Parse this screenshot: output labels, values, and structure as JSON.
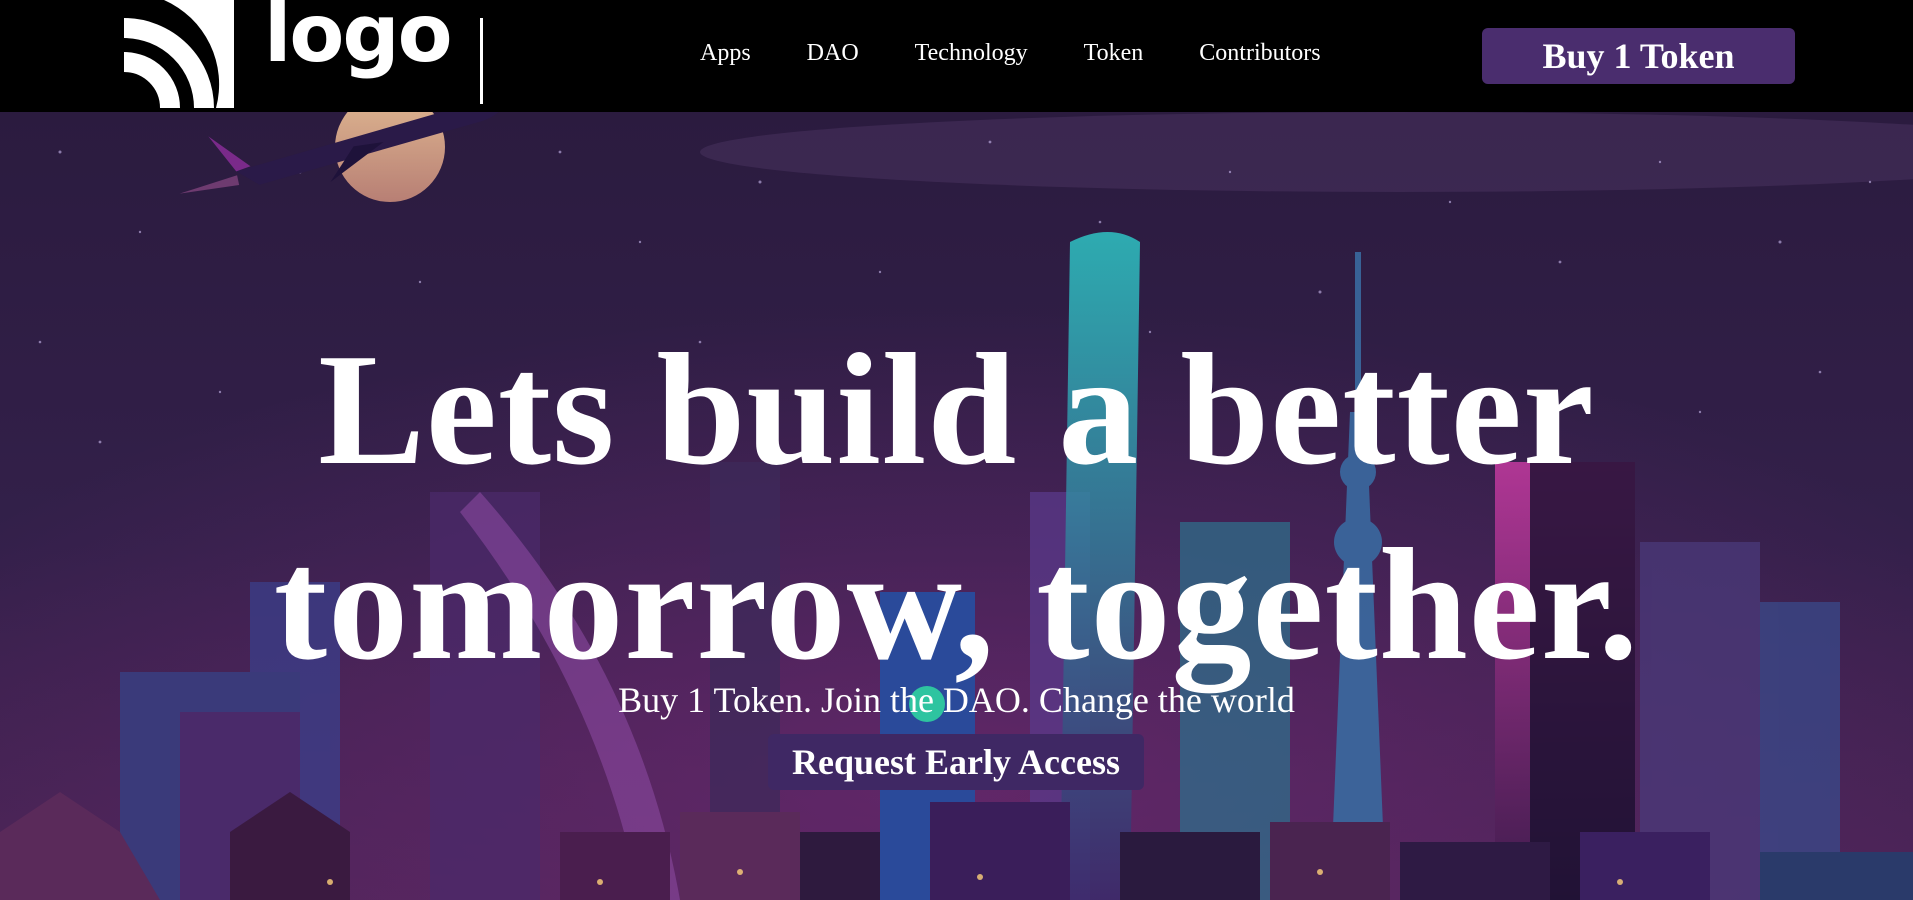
{
  "brand": {
    "logo_text": "logo",
    "logo_icon": "signal-arcs-icon"
  },
  "nav": {
    "links": [
      {
        "label": "Apps"
      },
      {
        "label": "DAO"
      },
      {
        "label": "Technology"
      },
      {
        "label": "Token"
      },
      {
        "label": "Contributors"
      }
    ],
    "buy_label": "Buy 1 Token"
  },
  "hero": {
    "title_line1": "Lets build a better",
    "title_line2": "tomorrow, together.",
    "subtitle": "Buy 1 Token. Join the DAO. Change the world",
    "cta_label": "Request Early Access",
    "background_image": "neon-city-skyline-with-airplane-illustration"
  },
  "colors": {
    "nav_background": "#000000",
    "button_purple": "#4a2d6e",
    "cta_purple": "#3f2864",
    "sky_top": "#2b1b3f",
    "text": "#ffffff"
  }
}
